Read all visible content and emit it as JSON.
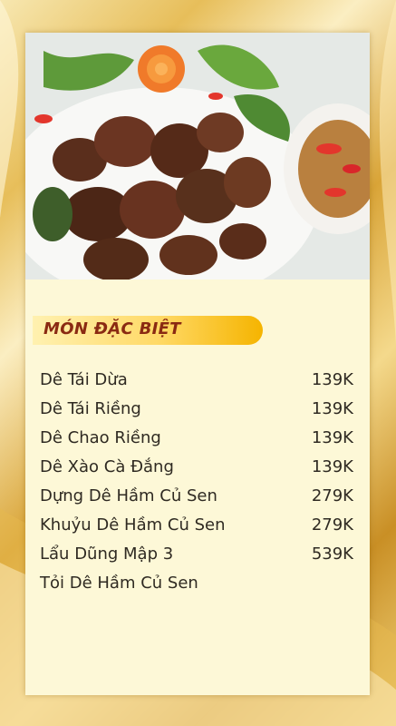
{
  "section": {
    "title": "MÓN ĐẶC BIỆT"
  },
  "menu": {
    "items": [
      {
        "name": "Dê Tái Dừa",
        "price": "139K"
      },
      {
        "name": "Dê Tái Riềng",
        "price": "139K"
      },
      {
        "name": "Dê Chao Riềng",
        "price": "139K"
      },
      {
        "name": "Dê Xào Cà Đắng",
        "price": "139K"
      },
      {
        "name": "Dựng Dê Hầm Củ Sen",
        "price": "279K"
      },
      {
        "name": "Khuỷu Dê Hầm Củ Sen",
        "price": "279K"
      },
      {
        "name": "Lẩu Dũng Mập 3",
        "price": "539K"
      },
      {
        "name": "Tỏi Dê Hầm Củ Sen",
        "price": ""
      }
    ]
  },
  "colors": {
    "card": "#fdf8d7",
    "banner": "#ffd966",
    "title": "#8a2a12",
    "text": "#2f2a22"
  }
}
